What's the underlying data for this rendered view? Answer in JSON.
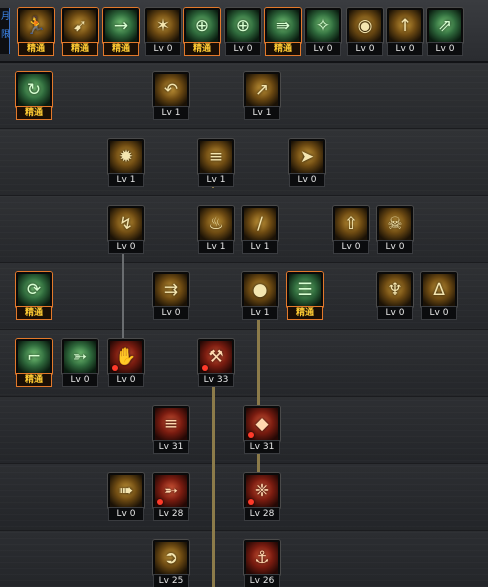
{
  "sidebar_tab": {
    "chars": [
      "月",
      "限"
    ]
  },
  "colors": {
    "master_label": "#ffcc33",
    "connector": "#8c7b4a",
    "locked_dot": "#ff3a2a"
  },
  "top_row": [
    {
      "icon": "runner-icon",
      "label": "精通",
      "style": "gold",
      "master": true
    },
    {
      "icon": "leap-icon",
      "label": "精通",
      "style": "gold",
      "master": true
    },
    {
      "icon": "dash-icon",
      "label": "精通",
      "style": "green",
      "master": true
    },
    {
      "icon": "eagle-wings-icon",
      "label": "Lv 0",
      "style": "gold"
    },
    {
      "icon": "crosshair-icon",
      "label": "精通",
      "style": "green",
      "master": true
    },
    {
      "icon": "crosshair-icon",
      "label": "Lv 0",
      "style": "green"
    },
    {
      "icon": "sprint-icon",
      "label": "精通",
      "style": "green",
      "master": true
    },
    {
      "icon": "aura-figure-icon",
      "label": "Lv 0",
      "style": "green"
    },
    {
      "icon": "eye-icon",
      "label": "Lv 0",
      "style": "gold"
    },
    {
      "icon": "power-up-icon",
      "label": "Lv 0",
      "style": "gold"
    },
    {
      "icon": "climb-icon",
      "label": "Lv 0",
      "style": "green"
    }
  ],
  "skills": [
    {
      "icon": "spin-kick-icon",
      "label": "精通",
      "style": "green",
      "master": true
    },
    {
      "icon": "backflip-arrow-icon",
      "label": "Lv 1",
      "style": "gold"
    },
    {
      "icon": "uppercut-icon",
      "label": "Lv 1",
      "style": "gold"
    },
    {
      "icon": "explosion-icon",
      "label": "Lv 1",
      "style": "gold"
    },
    {
      "icon": "bullet-barrage-icon",
      "label": "Lv 1",
      "style": "gold"
    },
    {
      "icon": "gun-shot-icon",
      "label": "Lv 0",
      "style": "gold"
    },
    {
      "icon": "swirl-kick-icon",
      "label": "Lv 0",
      "style": "gold"
    },
    {
      "icon": "fire-burst-icon",
      "label": "Lv 1",
      "style": "gold"
    },
    {
      "icon": "slash-icon",
      "label": "Lv 1",
      "style": "gold"
    },
    {
      "icon": "upload-box-icon",
      "label": "Lv 0",
      "style": "gold"
    },
    {
      "icon": "demon-head-icon",
      "label": "Lv 0",
      "style": "gold"
    },
    {
      "icon": "toggle-buff-icon",
      "label": "精通",
      "style": "green",
      "master": true
    },
    {
      "icon": "multi-shot-icon",
      "label": "Lv 0",
      "style": "gold"
    },
    {
      "icon": "grenade-icon",
      "label": "Lv 1",
      "style": "gold"
    },
    {
      "icon": "stacked-ammo-icon",
      "label": "精通",
      "style": "green",
      "master": true
    },
    {
      "icon": "trophy-cup-icon",
      "label": "Lv 0",
      "style": "gold"
    },
    {
      "icon": "landscape-blast-icon",
      "label": "Lv 0",
      "style": "gold"
    },
    {
      "icon": "revolver-icon",
      "label": "精通",
      "style": "green",
      "master": true
    },
    {
      "icon": "crossbow-icon",
      "label": "Lv 0",
      "style": "green"
    },
    {
      "icon": "grab-throw-icon",
      "label": "Lv 0",
      "style": "red",
      "locked": true
    },
    {
      "icon": "robot-armor-icon",
      "label": "Lv 33",
      "style": "red",
      "locked": true
    },
    {
      "icon": "claw-strike-icon",
      "label": "Lv 31",
      "style": "red"
    },
    {
      "icon": "bomb-icon",
      "label": "Lv 31",
      "style": "red",
      "locked": true
    },
    {
      "icon": "flame-gun-icon",
      "label": "Lv 0",
      "style": "gold"
    },
    {
      "icon": "missile-icon",
      "label": "Lv 28",
      "style": "red",
      "locked": true
    },
    {
      "icon": "bomb-cluster-icon",
      "label": "Lv 28",
      "style": "red",
      "locked": true
    },
    {
      "icon": "laser-cannon-icon",
      "label": "Lv 25",
      "style": "gold"
    },
    {
      "icon": "satellite-strike-icon",
      "label": "Lv 26",
      "style": "red"
    }
  ]
}
